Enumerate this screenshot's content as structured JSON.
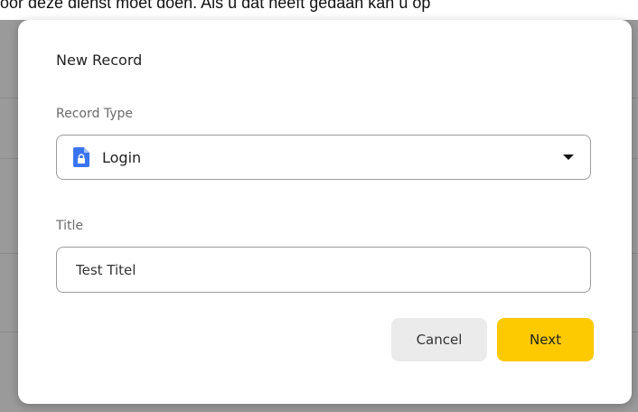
{
  "background": {
    "text": "oor deze dienst moet doen. Als u dat heeft gedaan kan u op"
  },
  "dialog": {
    "title": "New Record",
    "record_type": {
      "label": "Record Type",
      "value": "Login",
      "icon": "lock-document-icon"
    },
    "title_field": {
      "label": "Title",
      "value": "Test Titel"
    },
    "buttons": {
      "cancel": "Cancel",
      "next": "Next"
    }
  },
  "colors": {
    "accent": "#fdc900",
    "icon_blue": "#3b74f0",
    "cancel_bg": "#ebebeb"
  }
}
